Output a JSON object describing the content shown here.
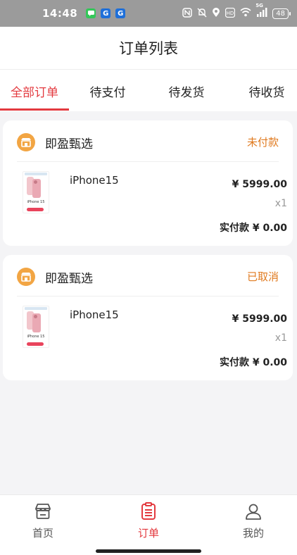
{
  "statusbar": {
    "time": "14:48",
    "apps": [
      {
        "icon": "message-app-icon",
        "color": "#34c759"
      },
      {
        "icon": "g-app-icon",
        "color": "#1e6fd9",
        "letter": "G"
      },
      {
        "icon": "g-app-icon",
        "color": "#1e6fd9",
        "letter": "G"
      }
    ],
    "network": "5G",
    "battery": "48"
  },
  "header": {
    "title": "订单列表"
  },
  "tabs": [
    {
      "label": "全部订单",
      "active": true
    },
    {
      "label": "待支付",
      "active": false
    },
    {
      "label": "待发货",
      "active": false
    },
    {
      "label": "待收货",
      "active": false
    }
  ],
  "orders": [
    {
      "shop": "即盈甄选",
      "status": "未付款",
      "product": {
        "name": "iPhone15",
        "thumb_text": "iPhone 15",
        "price": "¥ 5999.00",
        "qty": "x1"
      },
      "paid": "实付款 ¥ 0.00"
    },
    {
      "shop": "即盈甄选",
      "status": "已取消",
      "product": {
        "name": "iPhone15",
        "thumb_text": "iPhone 15",
        "price": "¥ 5999.00",
        "qty": "x1"
      },
      "paid": "实付款 ¥ 0.00"
    }
  ],
  "bottomnav": [
    {
      "label": "首页",
      "icon": "store-icon",
      "active": false
    },
    {
      "label": "订单",
      "icon": "order-list-icon",
      "active": true
    },
    {
      "label": "我的",
      "icon": "user-icon",
      "active": false
    }
  ],
  "colors": {
    "accent": "#e33a3f",
    "status_orange": "#e07a1f",
    "shop_icon": "#f2a543"
  }
}
